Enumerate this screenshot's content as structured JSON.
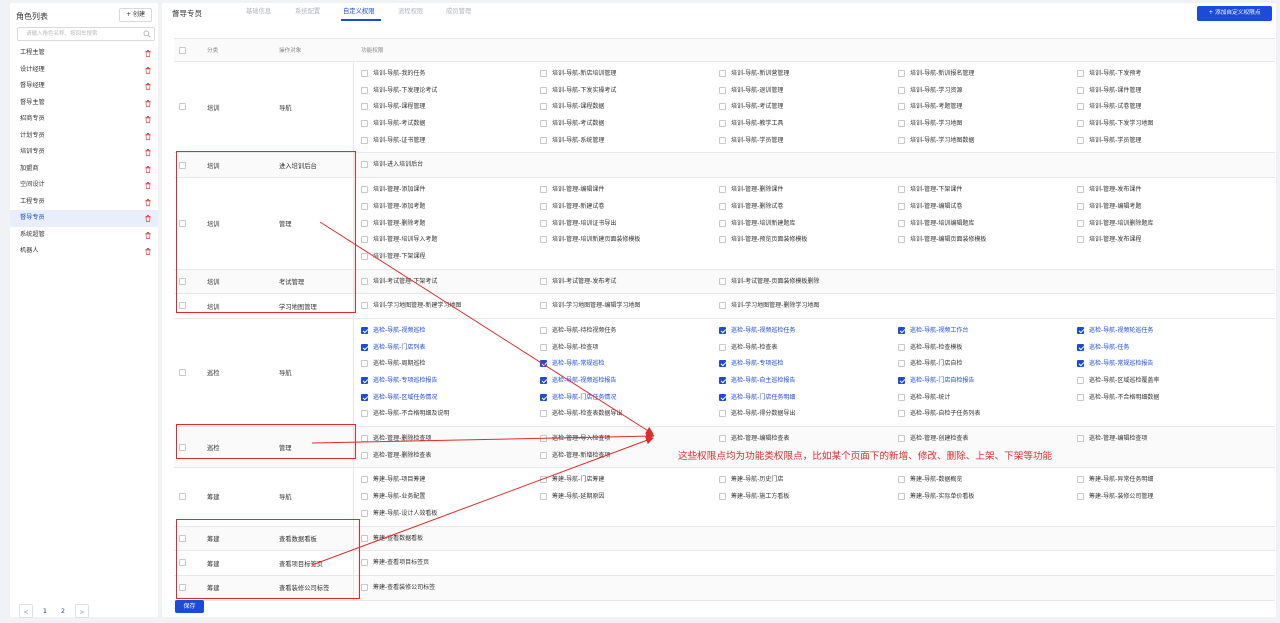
{
  "sidebar": {
    "title": "角色列表",
    "create_label": "+ 创建",
    "search_placeholder": "请输入角色名称、按回车搜索",
    "roles": [
      "工程主管",
      "设计经理",
      "督导经理",
      "督导主管",
      "招商专员",
      "计划专员",
      "培训专员",
      "加盟商",
      "空间设计",
      "工程专员",
      "督导专员",
      "系统超管",
      "机器人"
    ],
    "active_role": "督导专员",
    "pagination": {
      "prev": "<",
      "page1": "1",
      "page2": "2",
      "next": ">",
      "current": 2
    }
  },
  "header": {
    "title": "督导专员",
    "tabs": [
      {
        "label": "基础信息",
        "active": false
      },
      {
        "label": "系统配置",
        "active": false
      },
      {
        "label": "自定义权限",
        "active": true
      },
      {
        "label": "流程权限",
        "active": false
      },
      {
        "label": "成员管理",
        "active": false
      }
    ],
    "add_button": "+ 添加自定义权限点"
  },
  "table": {
    "columns": [
      "分类",
      "操作对象",
      "功能权限"
    ],
    "rows": [
      {
        "category": "培训",
        "object": "导航",
        "perms": [
          [
            "培训-导航-我的任务",
            false
          ],
          [
            "培训-导航-新店培训管理",
            false
          ],
          [
            "培训-导航-新训营管理",
            false
          ],
          [
            "培训-导航-新训报名管理",
            false
          ],
          [
            "培训-导航-下发预考",
            false
          ],
          [
            "培训-导航-下发理论考试",
            false
          ],
          [
            "培训-导航-下发实操考试",
            false
          ],
          [
            "培训-导航-退训管理",
            false
          ],
          [
            "培训-导航-学习资源",
            false
          ],
          [
            "培训-导航-课件管理",
            false
          ],
          [
            "培训-导航-课程管理",
            false
          ],
          [
            "培训-导航-课程数据",
            false
          ],
          [
            "培训-导航-考试管理",
            false
          ],
          [
            "培训-导航-考题管理",
            false
          ],
          [
            "培训-导航-试卷管理",
            false
          ],
          [
            "培训-导航-考试数据",
            false
          ],
          [
            "培训-导航-考试数据",
            false
          ],
          [
            "培训-导航-教学工具",
            false
          ],
          [
            "培训-导航-学习地图",
            false
          ],
          [
            "培训-导航-下发学习地图",
            false
          ],
          [
            "培训-导航-证书管理",
            false
          ],
          [
            "培训-导航-系统管理",
            false
          ],
          [
            "培训-导航-学员管理",
            false
          ],
          [
            "培训-导航-学习地图数据",
            false
          ],
          [
            "培训-导航-学员管理",
            false
          ]
        ]
      },
      {
        "category": "培训",
        "object": "进入培训后台",
        "perms": [
          [
            "培训-进入培训后台",
            false
          ]
        ]
      },
      {
        "category": "培训",
        "object": "管理",
        "perms": [
          [
            "培训-管理-添加课件",
            false
          ],
          [
            "培训-管理-编辑课件",
            false
          ],
          [
            "培训-管理-删除课件",
            false
          ],
          [
            "培训-管理-下架课件",
            false
          ],
          [
            "培训-管理-发布课件",
            false
          ],
          [
            "培训-管理-添加考题",
            false
          ],
          [
            "培训-管理-新建试卷",
            false
          ],
          [
            "培训-管理-删除试卷",
            false
          ],
          [
            "培训-管理-编辑试卷",
            false
          ],
          [
            "培训-管理-编辑考题",
            false
          ],
          [
            "培训-管理-删除考题",
            false
          ],
          [
            "培训-管理-培训证书导出",
            false
          ],
          [
            "培训-管理-培训新建题库",
            false
          ],
          [
            "培训-管理-培训编辑题库",
            false
          ],
          [
            "培训-管理-培训删除题库",
            false
          ],
          [
            "培训-管理-培训导入考题",
            false
          ],
          [
            "培训-管理-培训新建页面装修模板",
            false
          ],
          [
            "培训-管理-预览页面装修模板",
            false
          ],
          [
            "培训-管理-编辑页面装修模板",
            false
          ],
          [
            "培训-管理-发布课程",
            false
          ],
          [
            "培训-管理-下架课程",
            false
          ]
        ]
      },
      {
        "category": "培训",
        "object": "考试管理",
        "perms": [
          [
            "培训-考试管理-下架考试",
            false
          ],
          [
            "培训-考试管理-发布考试",
            false
          ],
          [
            "培训-考试管理-页面装修模板删除",
            false
          ]
        ]
      },
      {
        "category": "培训",
        "object": "学习地图管理",
        "perms": [
          [
            "培训-学习地图管理-新建学习地图",
            false
          ],
          [
            "培训-学习地图管理-编辑学习地图",
            false
          ],
          [
            "培训-学习地图管理-删除学习地图",
            false
          ]
        ]
      },
      {
        "category": "巡检",
        "object": "导航",
        "perms": [
          [
            "巡检-导航-视频巡检",
            true
          ],
          [
            "巡检-导航-待检视频任务",
            false
          ],
          [
            "巡检-导航-视频巡检任务",
            true
          ],
          [
            "巡检-导航-视频工作台",
            true
          ],
          [
            "巡检-导航-视频轮巡任务",
            true
          ],
          [
            "巡检-导航-门店列表",
            true
          ],
          [
            "巡检-导航-检查项",
            false
          ],
          [
            "巡检-导航-检查表",
            false
          ],
          [
            "巡检-导航-检查模板",
            false
          ],
          [
            "巡检-导航-任务",
            true
          ],
          [
            "巡检-导航-周期巡检",
            false
          ],
          [
            "巡检-导航-常规巡检",
            true
          ],
          [
            "巡检-导航-专项巡检",
            true
          ],
          [
            "巡检-导航-门店自检",
            false
          ],
          [
            "巡检-导航-常规巡检报告",
            true
          ],
          [
            "巡检-导航-专项巡检报告",
            true
          ],
          [
            "巡检-导航-视频巡检报告",
            true
          ],
          [
            "巡检-导航-自主巡检报告",
            true
          ],
          [
            "巡检-导航-门店自检报告",
            true
          ],
          [
            "巡检-导航-区域巡检覆盖率",
            false
          ],
          [
            "巡检-导航-区域任务情况",
            true
          ],
          [
            "巡检-导航-门店任务情况",
            true
          ],
          [
            "巡检-导航-门店任务明细",
            true
          ],
          [
            "巡检-导航-统计",
            false
          ],
          [
            "巡检-导航-不合格明细数据",
            false
          ],
          [
            "巡检-导航-不合格明细及说明",
            false
          ],
          [
            "巡检-导航-检查表数据导出",
            false
          ],
          [
            "巡检-导航-得分数据导出",
            false
          ],
          [
            "巡检-导航-自检子任务列表",
            false
          ]
        ]
      },
      {
        "category": "巡检",
        "object": "管理",
        "perms": [
          [
            "巡检-管理-删除检查项",
            false
          ],
          [
            "巡检-管理-导入检查项",
            false
          ],
          [
            "巡检-管理-编辑检查表",
            false
          ],
          [
            "巡检-管理-创建检查表",
            false
          ],
          [
            "巡检-管理-编辑检查项",
            false
          ],
          [
            "巡检-管理-删除检查表",
            false
          ],
          [
            "巡检-管理-新增检查项",
            false
          ]
        ]
      },
      {
        "category": "筹建",
        "object": "导航",
        "perms": [
          [
            "筹建-导航-项目筹建",
            false
          ],
          [
            "筹建-导航-门店筹建",
            false
          ],
          [
            "筹建-导航-历史门店",
            false
          ],
          [
            "筹建-导航-数据概览",
            false
          ],
          [
            "筹建-导航-异常任务明细",
            false
          ],
          [
            "筹建-导航-业务配置",
            false
          ],
          [
            "筹建-导航-延期原因",
            false
          ],
          [
            "筹建-导航-施工方看板",
            false
          ],
          [
            "筹建-导航-实际单价看板",
            false
          ],
          [
            "筹建-导航-装修公司管理",
            false
          ],
          [
            "筹建-导航-设计人效看板",
            false
          ]
        ]
      },
      {
        "category": "筹建",
        "object": "查看数据看板",
        "perms": [
          [
            "筹建-查看数据看板",
            false
          ]
        ]
      },
      {
        "category": "筹建",
        "object": "查看项目标签页",
        "perms": [
          [
            "筹建-查看项目标签页",
            false
          ]
        ]
      },
      {
        "category": "筹建",
        "object": "查看装修公司标签",
        "perms": [
          [
            "筹建-查看装修公司标签",
            false
          ]
        ]
      }
    ]
  },
  "save_label": "保存",
  "annotation": {
    "text": "这些权限点均为功能类权限点，比如某个页面下的新增、修改、删除、上架、下架等功能",
    "color": "#e02b2b"
  },
  "colors": {
    "accent": "#1b4bd8",
    "annotation": "#e02b2b"
  }
}
